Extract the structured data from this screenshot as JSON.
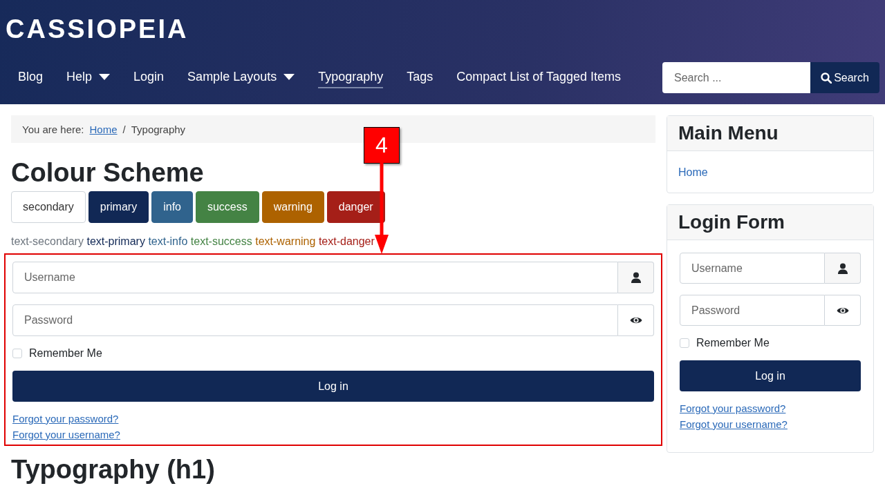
{
  "header": {
    "logo": "CASSIOPEIA",
    "nav": [
      {
        "label": "Blog",
        "has_dropdown": false,
        "selected": false
      },
      {
        "label": "Help",
        "has_dropdown": true,
        "selected": false
      },
      {
        "label": "Login",
        "has_dropdown": false,
        "selected": false
      },
      {
        "label": "Sample Layouts",
        "has_dropdown": true,
        "selected": false
      },
      {
        "label": "Typography",
        "has_dropdown": false,
        "selected": true
      },
      {
        "label": "Tags",
        "has_dropdown": false,
        "selected": false
      },
      {
        "label": "Compact List of Tagged Items",
        "has_dropdown": false,
        "selected": false
      }
    ],
    "search": {
      "placeholder": "Search ...",
      "button": "Search"
    }
  },
  "breadcrumb": {
    "prefix": "You are here:",
    "separator": "/",
    "items": [
      {
        "label": "Home",
        "kind": "link"
      },
      {
        "label": "Typography",
        "kind": "current"
      }
    ]
  },
  "content": {
    "heading": "Colour Scheme",
    "buttons": [
      {
        "label": "secondary",
        "color": "#ffffff"
      },
      {
        "label": "primary",
        "color": "#112855"
      },
      {
        "label": "info",
        "color": "#30638d"
      },
      {
        "label": "success",
        "color": "#448344"
      },
      {
        "label": "warning",
        "color": "#ad6200"
      },
      {
        "label": "danger",
        "color": "#a51f18"
      }
    ],
    "text_samples": [
      {
        "label": "text-secondary",
        "color": "#6d757e"
      },
      {
        "label": "text-primary",
        "color": "#112855"
      },
      {
        "label": "text-info",
        "color": "#30638d"
      },
      {
        "label": "text-success",
        "color": "#448344"
      },
      {
        "label": "text-warning",
        "color": "#ad6200"
      },
      {
        "label": "text-danger",
        "color": "#a51f18"
      }
    ],
    "login_form": {
      "highlighted": true,
      "username_placeholder": "Username",
      "password_placeholder": "Password",
      "remember": {
        "label": "Remember Me",
        "checked": false
      },
      "submit": "Log in",
      "links": [
        "Forgot your password?",
        "Forgot your username?"
      ]
    },
    "heading_2": "Typography (h1)"
  },
  "annotation": {
    "callout": "4"
  },
  "sidebar": {
    "main_menu": {
      "title": "Main Menu",
      "items": [
        "Home"
      ]
    },
    "login_form": {
      "title": "Login Form",
      "highlighted": false,
      "username_placeholder": "Username",
      "password_placeholder": "Password",
      "remember": {
        "label": "Remember Me",
        "checked": false
      },
      "submit": "Log in",
      "links": [
        "Forgot your password?",
        "Forgot your username?"
      ]
    }
  }
}
